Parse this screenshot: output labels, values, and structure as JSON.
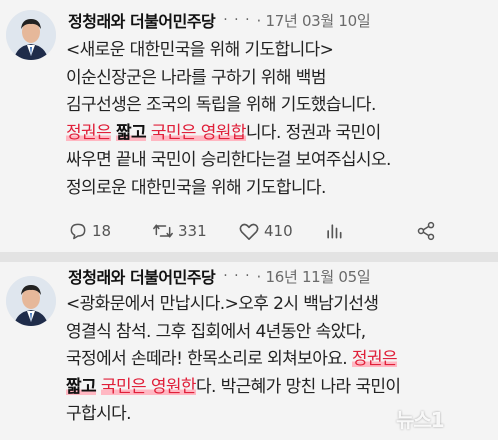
{
  "colors": {
    "highlight": "#ffb7c2",
    "highlight_text": "#e0203a",
    "background": "#f4f4f4"
  },
  "posts": [
    {
      "author": "정청래와 더불어민주당",
      "more": "· · ·",
      "date": "· 17년 03월 10일",
      "lines": [
        {
          "text": "<새로운 대한민국을 위해 기도합니다>"
        },
        {
          "text": "이순신장군은 나라를 구하기 위해 백범"
        },
        {
          "text": "김구선생은 조국의 독립을 위해 기도했습니다."
        },
        {
          "pre": "",
          "hl1": "정권은",
          "hl2": "짧고",
          "hl3": "국민은 영원합",
          "post": "니다. 정권과 국민이"
        },
        {
          "text": "싸우면 끝내 국민이 승리한다는걸 보여주십시오."
        },
        {
          "text": "정의로운 대한민국을 위해 기도합니다."
        }
      ],
      "actions": {
        "reply_icon": "comment-icon",
        "reply_count": "18",
        "retweet_icon": "retweet-icon",
        "retweet_count": "331",
        "like_icon": "heart-icon",
        "like_count": "410",
        "stats_icon": "bar-chart-icon",
        "share_icon": "share-icon"
      }
    },
    {
      "author": "정청래와 더불어민주당",
      "more": "· · ·",
      "date": "· 16년 11월 05일",
      "lines": [
        {
          "text": "<광화문에서 만납시다.>오후 2시 백남기선생"
        },
        {
          "text": "영결식 참석. 그후 집회에서 4년동안 속았다,"
        },
        {
          "pre": "국정에서 손떼라! 한목소리로 외쳐보아요. ",
          "hl1": "정권은"
        },
        {
          "hl2": "짧고",
          "hl3": "국민은 영원한",
          "post": "다. 박근혜가 망친 나라 국민이"
        },
        {
          "text": "구합시다."
        }
      ]
    }
  ],
  "watermark": "뉴스1"
}
